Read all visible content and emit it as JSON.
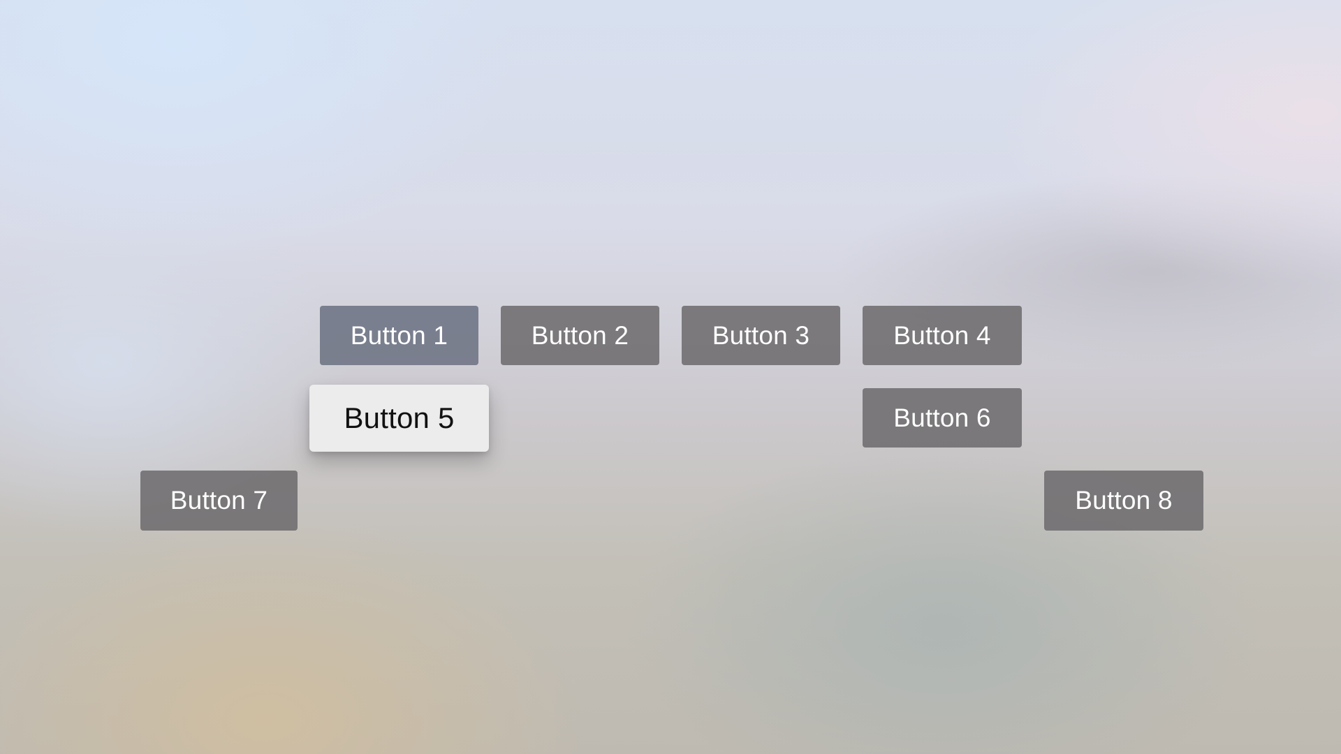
{
  "buttons": [
    {
      "label": "Button 1"
    },
    {
      "label": "Button 2"
    },
    {
      "label": "Button 3"
    },
    {
      "label": "Button 4"
    },
    {
      "label": "Button 5",
      "focused": true
    },
    {
      "label": "Button 6"
    },
    {
      "label": "Button 7"
    },
    {
      "label": "Button 8"
    }
  ],
  "colors": {
    "button_background": "#6e6c6e",
    "button_text": "#ffffff",
    "focused_background": "#ececec",
    "focused_text": "#111111"
  }
}
